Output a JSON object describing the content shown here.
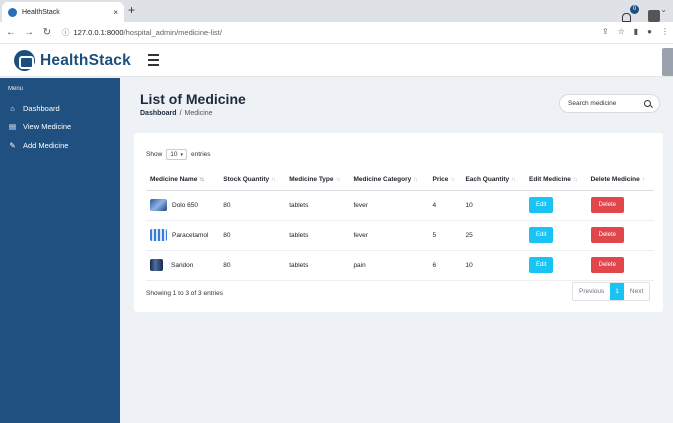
{
  "browser": {
    "tab_title": "HealthStack",
    "tab_close": "×",
    "new_tab": "+",
    "url_host": "127.0.0.1:8000",
    "url_path": "/hospital_admin/medicine-list/"
  },
  "header": {
    "logo_text": "HealthStack",
    "notification_count": "0"
  },
  "sidebar": {
    "menu_label": "Menu",
    "items": [
      {
        "label": "Dashboard"
      },
      {
        "label": "View Medicine"
      },
      {
        "label": "Add Medicine"
      }
    ]
  },
  "page": {
    "title": "List of Medicine",
    "breadcrumb_home": "Dashboard",
    "breadcrumb_sep": "/",
    "breadcrumb_current": "Medicine"
  },
  "search": {
    "placeholder": "Search medicine"
  },
  "table": {
    "show_label": "Show",
    "length_value": "10",
    "entries_label": "entries",
    "columns": [
      "Medicine Name",
      "Stock Quantity",
      "Medicine Type",
      "Medicine Category",
      "Price",
      "Each Quantity",
      "Edit Medicine",
      "Delete Medicine"
    ],
    "rows": [
      {
        "name": "Dolo 650",
        "stock": "80",
        "type": "tablets",
        "category": "fever",
        "price": "4",
        "each": "10",
        "edit": "Edit",
        "delete": "Delete"
      },
      {
        "name": "Paracetamol",
        "stock": "80",
        "type": "tablets",
        "category": "fever",
        "price": "5",
        "each": "25",
        "edit": "Edit",
        "delete": "Delete"
      },
      {
        "name": "Saridon",
        "stock": "80",
        "type": "tablets",
        "category": "pain",
        "price": "6",
        "each": "10",
        "edit": "Edit",
        "delete": "Delete"
      }
    ],
    "info": "Showing 1 to 3 of 3 entries",
    "pagination": {
      "previous": "Previous",
      "current": "1",
      "next": "Next"
    }
  },
  "colors": {
    "sidebar": "#1f5080",
    "brand": "#1b4f7e",
    "edit_button": "#19c4f5",
    "delete_button": "#e1464b",
    "background": "#eef1f6"
  }
}
